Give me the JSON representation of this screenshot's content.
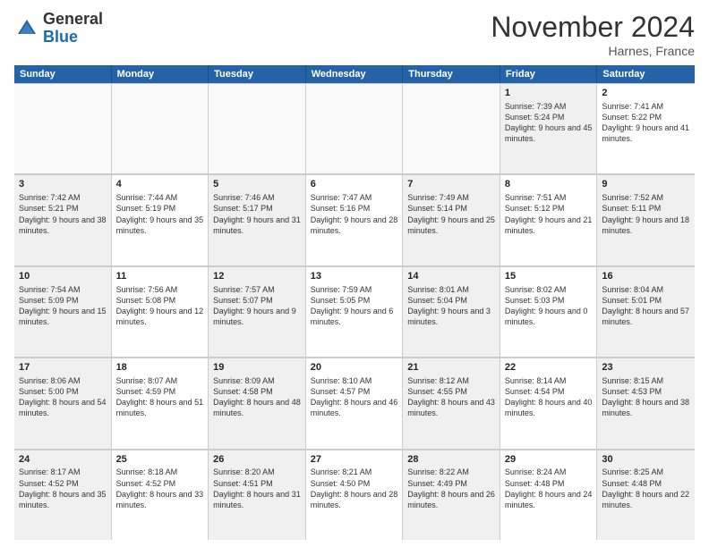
{
  "header": {
    "logo_general": "General",
    "logo_blue": "Blue",
    "month_title": "November 2024",
    "location": "Harnes, France"
  },
  "days_of_week": [
    "Sunday",
    "Monday",
    "Tuesday",
    "Wednesday",
    "Thursday",
    "Friday",
    "Saturday"
  ],
  "weeks": [
    [
      {
        "day": "",
        "text": "",
        "empty": true
      },
      {
        "day": "",
        "text": "",
        "empty": true
      },
      {
        "day": "",
        "text": "",
        "empty": true
      },
      {
        "day": "",
        "text": "",
        "empty": true
      },
      {
        "day": "",
        "text": "",
        "empty": true
      },
      {
        "day": "1",
        "text": "Sunrise: 7:39 AM\nSunset: 5:24 PM\nDaylight: 9 hours and 45 minutes.",
        "empty": false,
        "shaded": true
      },
      {
        "day": "2",
        "text": "Sunrise: 7:41 AM\nSunset: 5:22 PM\nDaylight: 9 hours and 41 minutes.",
        "empty": false
      }
    ],
    [
      {
        "day": "3",
        "text": "Sunrise: 7:42 AM\nSunset: 5:21 PM\nDaylight: 9 hours and 38 minutes.",
        "empty": false,
        "shaded": true
      },
      {
        "day": "4",
        "text": "Sunrise: 7:44 AM\nSunset: 5:19 PM\nDaylight: 9 hours and 35 minutes.",
        "empty": false
      },
      {
        "day": "5",
        "text": "Sunrise: 7:46 AM\nSunset: 5:17 PM\nDaylight: 9 hours and 31 minutes.",
        "empty": false,
        "shaded": true
      },
      {
        "day": "6",
        "text": "Sunrise: 7:47 AM\nSunset: 5:16 PM\nDaylight: 9 hours and 28 minutes.",
        "empty": false
      },
      {
        "day": "7",
        "text": "Sunrise: 7:49 AM\nSunset: 5:14 PM\nDaylight: 9 hours and 25 minutes.",
        "empty": false,
        "shaded": true
      },
      {
        "day": "8",
        "text": "Sunrise: 7:51 AM\nSunset: 5:12 PM\nDaylight: 9 hours and 21 minutes.",
        "empty": false
      },
      {
        "day": "9",
        "text": "Sunrise: 7:52 AM\nSunset: 5:11 PM\nDaylight: 9 hours and 18 minutes.",
        "empty": false,
        "shaded": true
      }
    ],
    [
      {
        "day": "10",
        "text": "Sunrise: 7:54 AM\nSunset: 5:09 PM\nDaylight: 9 hours and 15 minutes.",
        "empty": false,
        "shaded": true
      },
      {
        "day": "11",
        "text": "Sunrise: 7:56 AM\nSunset: 5:08 PM\nDaylight: 9 hours and 12 minutes.",
        "empty": false
      },
      {
        "day": "12",
        "text": "Sunrise: 7:57 AM\nSunset: 5:07 PM\nDaylight: 9 hours and 9 minutes.",
        "empty": false,
        "shaded": true
      },
      {
        "day": "13",
        "text": "Sunrise: 7:59 AM\nSunset: 5:05 PM\nDaylight: 9 hours and 6 minutes.",
        "empty": false
      },
      {
        "day": "14",
        "text": "Sunrise: 8:01 AM\nSunset: 5:04 PM\nDaylight: 9 hours and 3 minutes.",
        "empty": false,
        "shaded": true
      },
      {
        "day": "15",
        "text": "Sunrise: 8:02 AM\nSunset: 5:03 PM\nDaylight: 9 hours and 0 minutes.",
        "empty": false
      },
      {
        "day": "16",
        "text": "Sunrise: 8:04 AM\nSunset: 5:01 PM\nDaylight: 8 hours and 57 minutes.",
        "empty": false,
        "shaded": true
      }
    ],
    [
      {
        "day": "17",
        "text": "Sunrise: 8:06 AM\nSunset: 5:00 PM\nDaylight: 8 hours and 54 minutes.",
        "empty": false,
        "shaded": true
      },
      {
        "day": "18",
        "text": "Sunrise: 8:07 AM\nSunset: 4:59 PM\nDaylight: 8 hours and 51 minutes.",
        "empty": false
      },
      {
        "day": "19",
        "text": "Sunrise: 8:09 AM\nSunset: 4:58 PM\nDaylight: 8 hours and 48 minutes.",
        "empty": false,
        "shaded": true
      },
      {
        "day": "20",
        "text": "Sunrise: 8:10 AM\nSunset: 4:57 PM\nDaylight: 8 hours and 46 minutes.",
        "empty": false
      },
      {
        "day": "21",
        "text": "Sunrise: 8:12 AM\nSunset: 4:55 PM\nDaylight: 8 hours and 43 minutes.",
        "empty": false,
        "shaded": true
      },
      {
        "day": "22",
        "text": "Sunrise: 8:14 AM\nSunset: 4:54 PM\nDaylight: 8 hours and 40 minutes.",
        "empty": false
      },
      {
        "day": "23",
        "text": "Sunrise: 8:15 AM\nSunset: 4:53 PM\nDaylight: 8 hours and 38 minutes.",
        "empty": false,
        "shaded": true
      }
    ],
    [
      {
        "day": "24",
        "text": "Sunrise: 8:17 AM\nSunset: 4:52 PM\nDaylight: 8 hours and 35 minutes.",
        "empty": false,
        "shaded": true
      },
      {
        "day": "25",
        "text": "Sunrise: 8:18 AM\nSunset: 4:52 PM\nDaylight: 8 hours and 33 minutes.",
        "empty": false
      },
      {
        "day": "26",
        "text": "Sunrise: 8:20 AM\nSunset: 4:51 PM\nDaylight: 8 hours and 31 minutes.",
        "empty": false,
        "shaded": true
      },
      {
        "day": "27",
        "text": "Sunrise: 8:21 AM\nSunset: 4:50 PM\nDaylight: 8 hours and 28 minutes.",
        "empty": false
      },
      {
        "day": "28",
        "text": "Sunrise: 8:22 AM\nSunset: 4:49 PM\nDaylight: 8 hours and 26 minutes.",
        "empty": false,
        "shaded": true
      },
      {
        "day": "29",
        "text": "Sunrise: 8:24 AM\nSunset: 4:48 PM\nDaylight: 8 hours and 24 minutes.",
        "empty": false
      },
      {
        "day": "30",
        "text": "Sunrise: 8:25 AM\nSunset: 4:48 PM\nDaylight: 8 hours and 22 minutes.",
        "empty": false,
        "shaded": true
      }
    ]
  ]
}
